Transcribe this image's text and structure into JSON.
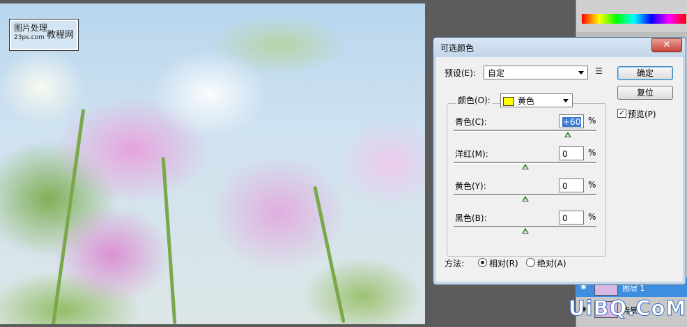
{
  "watermark": {
    "line1": "图片处理",
    "line2": "23ps.com",
    "line3": "教程网"
  },
  "dialog": {
    "title": "可选颜色",
    "close_glyph": "✕",
    "preset_label": "预设(E):",
    "preset_value": "自定",
    "ok_label": "确定",
    "reset_label": "复位",
    "preview_label": "预览(P)",
    "preview_checked": true,
    "colors_label": "颜色(O):",
    "colors_value": "黄色",
    "colors_swatch": "#ffff00",
    "sliders": [
      {
        "label": "青色(C):",
        "value": "+60",
        "fraction": 0.8,
        "unit": "%"
      },
      {
        "label": "洋红(M):",
        "value": "0",
        "fraction": 0.5,
        "unit": "%"
      },
      {
        "label": "黄色(Y):",
        "value": "0",
        "fraction": 0.5,
        "unit": "%"
      },
      {
        "label": "黑色(B):",
        "value": "0",
        "fraction": 0.5,
        "unit": "%"
      }
    ],
    "method_label": "方法:",
    "method_relative": "相对(R)",
    "method_absolute": "绝对(A)",
    "method_selected": "relative"
  },
  "layers": {
    "layer1": "图层 1",
    "layer2": "背景"
  },
  "brand": "UiBQ.CoM",
  "icons": {
    "preset_menu": "menu-lines-icon",
    "eye": "eye-icon",
    "close": "close-icon"
  }
}
